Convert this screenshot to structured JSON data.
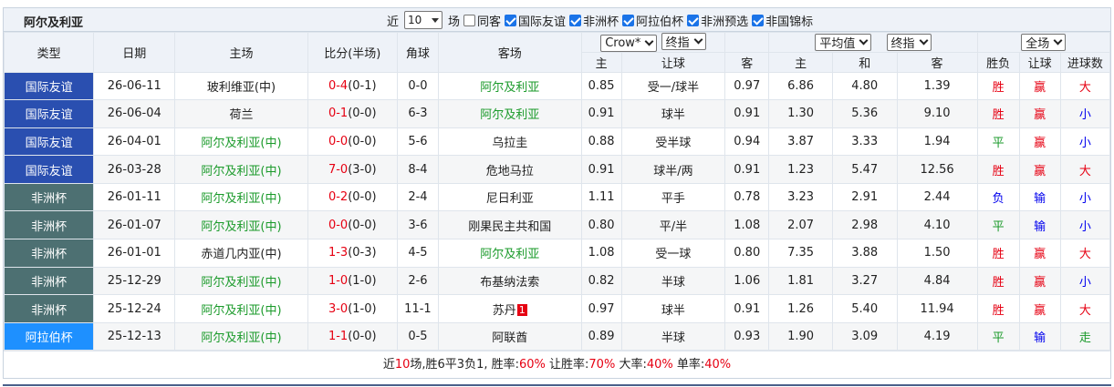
{
  "header": {
    "team": "阿尔及利亚",
    "recent_prefix": "近",
    "recent_count": "10",
    "recent_suffix": "场",
    "same_home_label": "同客",
    "filters": [
      "国际友谊",
      "非洲杯",
      "阿拉伯杯",
      "非洲预选",
      "非国锦标"
    ]
  },
  "columns": {
    "type": "类型",
    "date": "日期",
    "home": "主场",
    "score": "比分(半场)",
    "corner": "角球",
    "away": "客场",
    "company": "Crow*",
    "handicap_select": "终指",
    "avg_select": "平均值",
    "euro_select": "终指",
    "scope_select": "全场",
    "sub_home": "主",
    "sub_line": "让球",
    "sub_away": "客",
    "sub_e_home": "主",
    "sub_e_draw": "和",
    "sub_e_away": "客",
    "sub_result": "胜负",
    "sub_ah_result": "让球",
    "sub_goals": "进球数"
  },
  "colors": {
    "friendly": "#2a4fb0",
    "afcon": "#4d7072",
    "arab": "#1e90ff",
    "win": "#e60012",
    "draw": "#1a9a2a",
    "loss": "#0000ee"
  },
  "rows": [
    {
      "league": "国际友谊",
      "lc": "#2a4fb0",
      "date": "26-06-11",
      "home": "玻利维亚(中)",
      "hc": "",
      "score": "0-4",
      "ht": "(0-1)",
      "corner": "0-0",
      "away": "阿尔及利亚",
      "ac": "green",
      "red": "",
      "ah_h": "0.85",
      "ah_line": "受一/球半",
      "ah_a": "0.97",
      "e_h": "6.86",
      "e_d": "4.80",
      "e_a": "1.39",
      "res": "胜",
      "rc": "red",
      "ahr": "赢",
      "ahrc": "red",
      "goals": "大",
      "gc": "red"
    },
    {
      "league": "国际友谊",
      "lc": "#2a4fb0",
      "date": "26-06-04",
      "home": "荷兰",
      "hc": "",
      "score": "0-1",
      "ht": "(0-0)",
      "corner": "6-3",
      "away": "阿尔及利亚",
      "ac": "green",
      "red": "",
      "ah_h": "0.91",
      "ah_line": "球半",
      "ah_a": "0.91",
      "e_h": "1.30",
      "e_d": "5.36",
      "e_a": "9.10",
      "res": "胜",
      "rc": "red",
      "ahr": "赢",
      "ahrc": "red",
      "goals": "小",
      "gc": "blue"
    },
    {
      "league": "国际友谊",
      "lc": "#2a4fb0",
      "date": "26-04-01",
      "home": "阿尔及利亚(中)",
      "hc": "green",
      "score": "0-0",
      "ht": "(0-0)",
      "corner": "5-6",
      "away": "乌拉圭",
      "ac": "",
      "red": "",
      "ah_h": "0.88",
      "ah_line": "受半球",
      "ah_a": "0.94",
      "e_h": "3.87",
      "e_d": "3.33",
      "e_a": "1.94",
      "res": "平",
      "rc": "green",
      "ahr": "赢",
      "ahrc": "red",
      "goals": "小",
      "gc": "blue"
    },
    {
      "league": "国际友谊",
      "lc": "#2a4fb0",
      "date": "26-03-28",
      "home": "阿尔及利亚(中)",
      "hc": "green",
      "score": "7-0",
      "ht": "(3-0)",
      "corner": "8-4",
      "away": "危地马拉",
      "ac": "",
      "red": "",
      "ah_h": "0.91",
      "ah_line": "球半/两",
      "ah_a": "0.91",
      "e_h": "1.23",
      "e_d": "5.47",
      "e_a": "12.56",
      "res": "胜",
      "rc": "red",
      "ahr": "赢",
      "ahrc": "red",
      "goals": "大",
      "gc": "red"
    },
    {
      "league": "非洲杯",
      "lc": "#4d7072",
      "date": "26-01-11",
      "home": "阿尔及利亚(中)",
      "hc": "green",
      "score": "0-2",
      "ht": "(0-0)",
      "corner": "2-4",
      "away": "尼日利亚",
      "ac": "",
      "red": "",
      "ah_h": "1.11",
      "ah_line": "平手",
      "ah_a": "0.78",
      "e_h": "3.23",
      "e_d": "2.91",
      "e_a": "2.44",
      "res": "负",
      "rc": "blue",
      "ahr": "输",
      "ahrc": "blue",
      "goals": "小",
      "gc": "blue"
    },
    {
      "league": "非洲杯",
      "lc": "#4d7072",
      "date": "26-01-07",
      "home": "阿尔及利亚(中)",
      "hc": "green",
      "score": "0-0",
      "ht": "(0-0)",
      "corner": "3-6",
      "away": "刚果民主共和国",
      "ac": "",
      "red": "",
      "ah_h": "0.80",
      "ah_line": "平/半",
      "ah_a": "1.08",
      "e_h": "2.07",
      "e_d": "2.98",
      "e_a": "4.10",
      "res": "平",
      "rc": "green",
      "ahr": "输",
      "ahrc": "blue",
      "goals": "小",
      "gc": "blue"
    },
    {
      "league": "非洲杯",
      "lc": "#4d7072",
      "date": "26-01-01",
      "home": "赤道几内亚(中)",
      "hc": "",
      "score": "1-3",
      "ht": "(0-3)",
      "corner": "4-5",
      "away": "阿尔及利亚",
      "ac": "green",
      "red": "",
      "ah_h": "1.08",
      "ah_line": "受一球",
      "ah_a": "0.80",
      "e_h": "7.35",
      "e_d": "3.88",
      "e_a": "1.50",
      "res": "胜",
      "rc": "red",
      "ahr": "赢",
      "ahrc": "red",
      "goals": "大",
      "gc": "red"
    },
    {
      "league": "非洲杯",
      "lc": "#4d7072",
      "date": "25-12-29",
      "home": "阿尔及利亚(中)",
      "hc": "green",
      "score": "1-0",
      "ht": "(1-0)",
      "corner": "2-6",
      "away": "布基纳法索",
      "ac": "",
      "red": "",
      "ah_h": "0.82",
      "ah_line": "半球",
      "ah_a": "1.06",
      "e_h": "1.81",
      "e_d": "3.27",
      "e_a": "4.84",
      "res": "胜",
      "rc": "red",
      "ahr": "赢",
      "ahrc": "red",
      "goals": "小",
      "gc": "blue"
    },
    {
      "league": "非洲杯",
      "lc": "#4d7072",
      "date": "25-12-24",
      "home": "阿尔及利亚(中)",
      "hc": "green",
      "score": "3-0",
      "ht": "(1-0)",
      "corner": "11-1",
      "away": "苏丹",
      "ac": "",
      "red": "1",
      "ah_h": "0.97",
      "ah_line": "球半",
      "ah_a": "0.91",
      "e_h": "1.26",
      "e_d": "5.40",
      "e_a": "11.94",
      "res": "胜",
      "rc": "red",
      "ahr": "赢",
      "ahrc": "red",
      "goals": "大",
      "gc": "red"
    },
    {
      "league": "阿拉伯杯",
      "lc": "#1e90ff",
      "date": "25-12-13",
      "home": "阿尔及利亚(中)",
      "hc": "green",
      "score": "1-1",
      "ht": "(0-0)",
      "corner": "0-5",
      "away": "阿联酋",
      "ac": "",
      "red": "",
      "ah_h": "0.89",
      "ah_line": "半球",
      "ah_a": "0.93",
      "e_h": "1.90",
      "e_d": "3.09",
      "e_a": "4.19",
      "res": "平",
      "rc": "green",
      "ahr": "输",
      "ahrc": "blue",
      "goals": "走",
      "gc": "green"
    }
  ],
  "summary": {
    "p1": "近",
    "count": "10",
    "p2": "场,胜6平3负1, 胜率:",
    "win_rate": "60%",
    "p3": " 让胜率:",
    "ah_rate": "70%",
    "p4": " 大率:",
    "over_rate": "40%",
    "p5": " 单率:",
    "odd_rate": "40%"
  }
}
